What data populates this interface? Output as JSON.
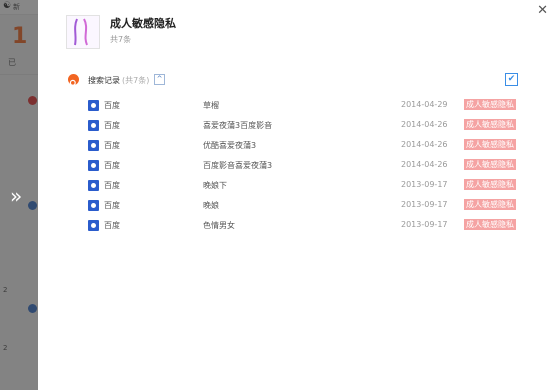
{
  "background_app": {
    "title_fragment": "新",
    "stat_number": "1",
    "stat_fragment": "已",
    "side_numbers": [
      "2",
      "2"
    ]
  },
  "panel": {
    "category_title": "成人敏感隐私",
    "category_count": "共7条",
    "section_label": "搜索记录",
    "section_count": "(共7条)",
    "collapse_glyph": "^",
    "check_glyph": "✔",
    "close_glyph": "✕",
    "expand_glyph": "»",
    "rows": [
      {
        "engine": "百度",
        "keyword": "草榴",
        "date": "2014-04-29",
        "tag": "成人敏感隐私"
      },
      {
        "engine": "百度",
        "keyword": "喜爱夜蒲3百度影音",
        "date": "2014-04-26",
        "tag": "成人敏感隐私"
      },
      {
        "engine": "百度",
        "keyword": "优酷喜爱夜蒲3",
        "date": "2014-04-26",
        "tag": "成人敏感隐私"
      },
      {
        "engine": "百度",
        "keyword": "百度影音喜爱夜蒲3",
        "date": "2014-04-26",
        "tag": "成人敏感隐私"
      },
      {
        "engine": "百度",
        "keyword": "晚娘下",
        "date": "2013-09-17",
        "tag": "成人敏感隐私"
      },
      {
        "engine": "百度",
        "keyword": "晚娘",
        "date": "2013-09-17",
        "tag": "成人敏感隐私"
      },
      {
        "engine": "百度",
        "keyword": "色情男女",
        "date": "2013-09-17",
        "tag": "成人敏感隐私"
      }
    ]
  },
  "colors": {
    "accent_orange": "#f26522",
    "tag_pink": "#f5a3a3",
    "baidu_blue": "#2a5ccc",
    "check_blue": "#3a8ee6"
  }
}
